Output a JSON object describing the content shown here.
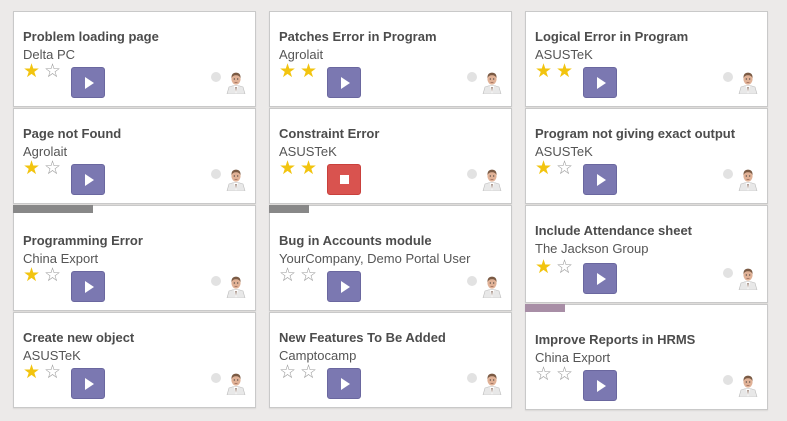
{
  "colors": {
    "play": "#7b78b1",
    "stop": "#d9534f",
    "star_on": "#f2c40f",
    "star_off": "#9a9a9a"
  },
  "columns": [
    {
      "cards": [
        {
          "title": "Problem loading page",
          "customer": "Delta PC",
          "stars": 1,
          "action": "play",
          "color_bar": null
        },
        {
          "title": "Page not Found",
          "customer": "Agrolait",
          "stars": 1,
          "action": "play",
          "color_bar": null
        },
        {
          "title": "Programming Error",
          "customer": "China Export",
          "stars": 1,
          "action": "play",
          "color_bar": "#888888"
        },
        {
          "title": "Create new object",
          "customer": "ASUSTeK",
          "stars": 1,
          "action": "play",
          "color_bar": null
        }
      ]
    },
    {
      "cards": [
        {
          "title": "Patches Error in Program",
          "customer": "Agrolait",
          "stars": 2,
          "action": "play",
          "color_bar": null
        },
        {
          "title": "Constraint Error",
          "customer": "ASUSTeK",
          "stars": 2,
          "action": "stop",
          "color_bar": null
        },
        {
          "title": "Bug in Accounts module",
          "customer": "YourCompany, Demo Portal User",
          "stars": 0,
          "action": "play",
          "color_bar": "#888888"
        },
        {
          "title": "New Features To Be Added",
          "customer": "Camptocamp",
          "stars": 0,
          "action": "play",
          "color_bar": null
        }
      ]
    },
    {
      "cards": [
        {
          "title": "Logical Error in Program",
          "customer": "ASUSTeK",
          "stars": 2,
          "action": "play",
          "color_bar": null
        },
        {
          "title": "Program not giving exact output",
          "customer": "ASUSTeK",
          "stars": 1,
          "action": "play",
          "color_bar": null
        },
        {
          "title": "Include Attendance sheet",
          "customer": "The Jackson Group",
          "stars": 1,
          "action": "play",
          "color_bar": null
        },
        {
          "title": "Improve Reports in HRMS",
          "customer": "China Export",
          "stars": 0,
          "action": "play",
          "color_bar": "#a88ea6"
        }
      ]
    }
  ]
}
